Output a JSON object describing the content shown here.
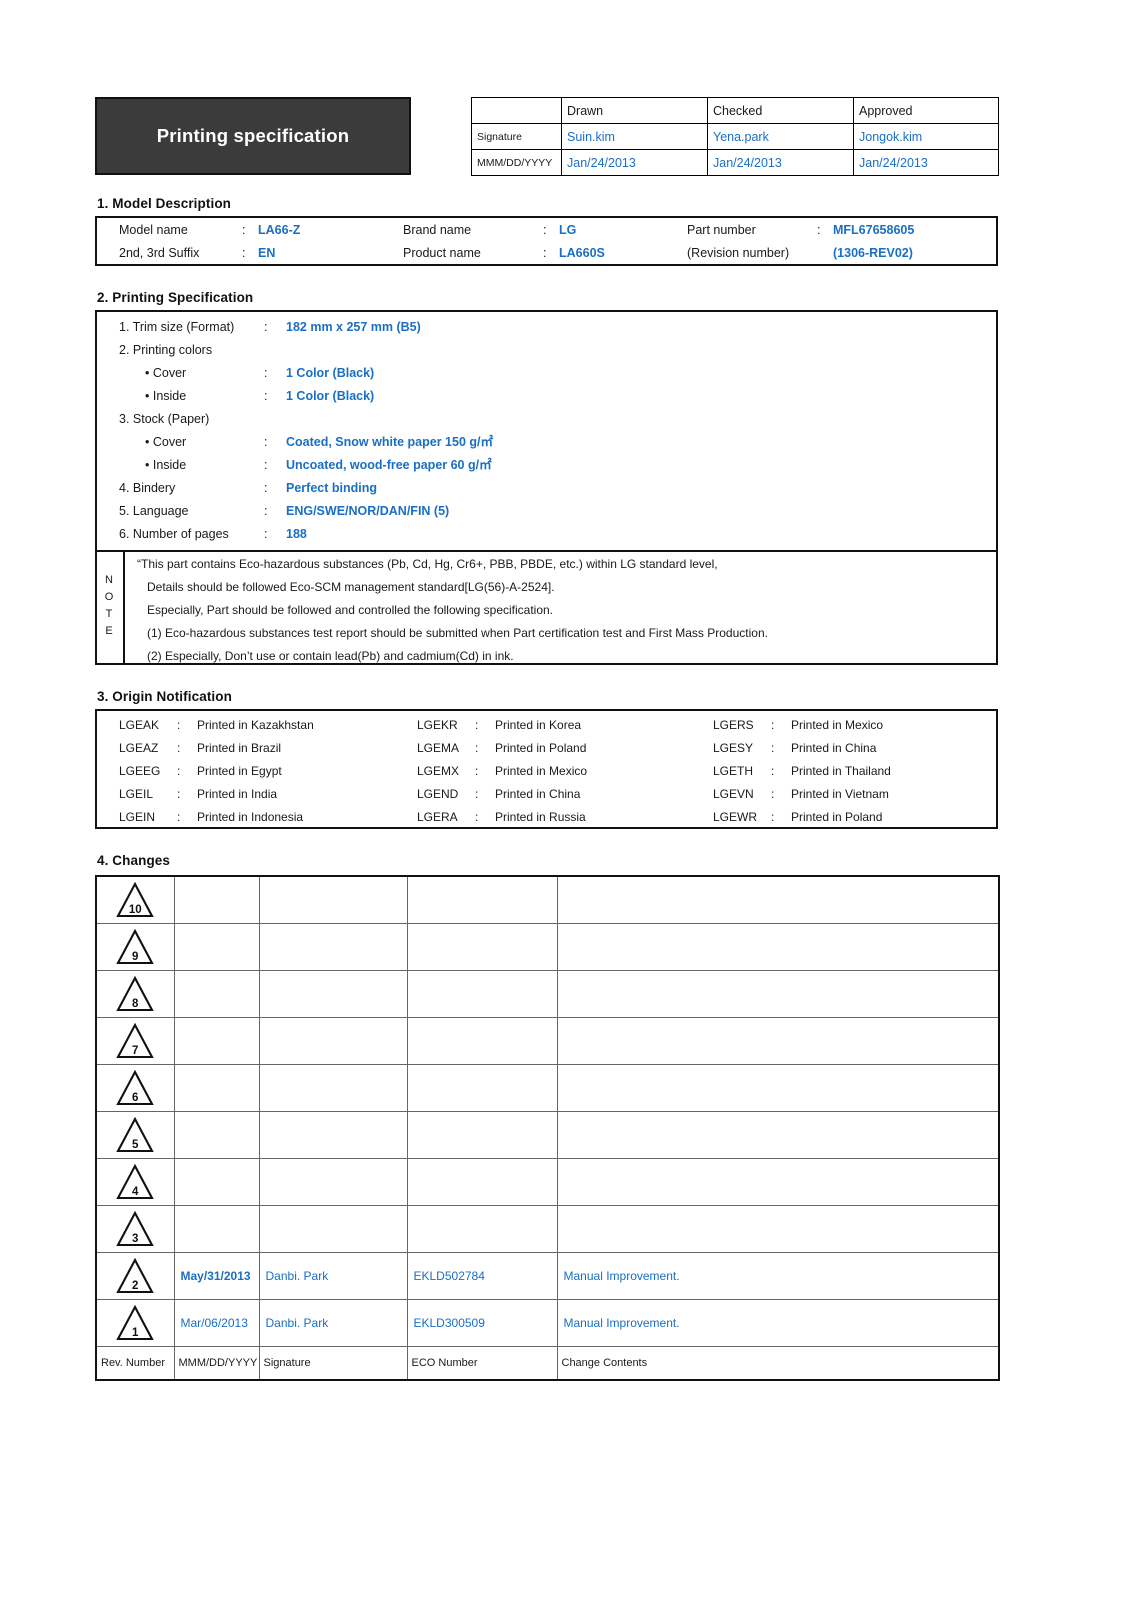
{
  "document": {
    "title": "Printing specification"
  },
  "approval": {
    "columns": [
      "Drawn",
      "Checked",
      "Approved"
    ],
    "rows": [
      {
        "label": "Signature",
        "values": [
          "Suin.kim",
          "Yena.park",
          "Jongok.kim"
        ]
      },
      {
        "label": "MMM/DD/YYYY",
        "values": [
          "Jan/24/2013",
          "Jan/24/2013",
          "Jan/24/2013"
        ]
      }
    ]
  },
  "sections": {
    "model": "1. Model Description",
    "printing": "2. Printing Specification",
    "origin": "3. Origin Notification",
    "changes": "4. Changes"
  },
  "model": {
    "colon": ":",
    "fields": [
      {
        "label": "Model name",
        "value": "LA66-Z"
      },
      {
        "label": "Brand name",
        "value": "LG"
      },
      {
        "label": "Part number",
        "value": "MFL67658605"
      },
      {
        "label": "2nd, 3rd Suffix",
        "value": "EN"
      },
      {
        "label": "Product name",
        "value": "LA660S"
      },
      {
        "label": "(Revision number)",
        "value": "(1306-REV02)"
      }
    ]
  },
  "printing": {
    "colon": ":",
    "items": [
      {
        "label": "1. Trim size (Format)",
        "value": "182 mm x 257 mm (B5)"
      },
      {
        "label": "2. Printing colors",
        "value": ""
      },
      {
        "label": "• Cover",
        "value": "1 Color (Black)"
      },
      {
        "label": "• Inside",
        "value": "1 Color (Black)"
      },
      {
        "label": "3. Stock (Paper)",
        "value": ""
      },
      {
        "label": "• Cover",
        "value": "Coated, Snow white paper 150 g/㎡"
      },
      {
        "label": "• Inside",
        "value": "Uncoated, wood-free paper 60 g/㎡"
      },
      {
        "label": "4. Bindery",
        "value": "Perfect binding"
      },
      {
        "label": "5. Language",
        "value": "ENG/SWE/NOR/DAN/FIN (5)"
      },
      {
        "label": "6. Number of pages",
        "value": "188"
      }
    ]
  },
  "note": {
    "vertical_label": "NOTE",
    "lines": [
      "“This part contains Eco-hazardous substances (Pb, Cd, Hg, Cr6+, PBB, PBDE, etc.) within LG standard level,",
      "Details should be followed Eco-SCM management standard[LG(56)-A-2524].",
      "Especially, Part should be followed and controlled the following specification.",
      "(1) Eco-hazardous substances test report should be submitted when Part certification test and First Mass Production.",
      "(2) Especially, Don’t use or contain lead(Pb) and cadmium(Cd) in ink."
    ]
  },
  "origin": {
    "colon": ":",
    "columns": [
      [
        {
          "code": "LGEAK",
          "place": "Printed in Kazakhstan"
        },
        {
          "code": "LGEAZ",
          "place": "Printed in Brazil"
        },
        {
          "code": "LGEEG",
          "place": "Printed in Egypt"
        },
        {
          "code": "LGEIL",
          "place": "Printed in India"
        },
        {
          "code": "LGEIN",
          "place": "Printed in Indonesia"
        }
      ],
      [
        {
          "code": "LGEKR",
          "place": "Printed in Korea"
        },
        {
          "code": "LGEMA",
          "place": "Printed in Poland"
        },
        {
          "code": "LGEMX",
          "place": "Printed in Mexico"
        },
        {
          "code": "LGEND",
          "place": "Printed in China"
        },
        {
          "code": "LGERA",
          "place": "Printed in Russia"
        }
      ],
      [
        {
          "code": "LGERS",
          "place": "Printed in Mexico"
        },
        {
          "code": "LGESY",
          "place": "Printed in China"
        },
        {
          "code": "LGETH",
          "place": "Printed in Thailand"
        },
        {
          "code": "LGEVN",
          "place": "Printed in Vietnam"
        },
        {
          "code": "LGEWR",
          "place": "Printed in Poland"
        }
      ]
    ]
  },
  "changes": {
    "footer": {
      "rev": "Rev. Number",
      "date": "MMM/DD/YYYY",
      "signature": "Signature",
      "eco": "ECO Number",
      "contents": "Change Contents"
    },
    "rows": [
      {
        "rev": "10",
        "date": "",
        "signature": "",
        "eco": "",
        "contents": "",
        "date_bold": false
      },
      {
        "rev": "9",
        "date": "",
        "signature": "",
        "eco": "",
        "contents": "",
        "date_bold": false
      },
      {
        "rev": "8",
        "date": "",
        "signature": "",
        "eco": "",
        "contents": "",
        "date_bold": false
      },
      {
        "rev": "7",
        "date": "",
        "signature": "",
        "eco": "",
        "contents": "",
        "date_bold": false
      },
      {
        "rev": "6",
        "date": "",
        "signature": "",
        "eco": "",
        "contents": "",
        "date_bold": false
      },
      {
        "rev": "5",
        "date": "",
        "signature": "",
        "eco": "",
        "contents": "",
        "date_bold": false
      },
      {
        "rev": "4",
        "date": "",
        "signature": "",
        "eco": "",
        "contents": "",
        "date_bold": false
      },
      {
        "rev": "3",
        "date": "",
        "signature": "",
        "eco": "",
        "contents": "",
        "date_bold": false
      },
      {
        "rev": "2",
        "date": "May/31/2013",
        "signature": "Danbi. Park",
        "eco": "EKLD502784",
        "contents": "Manual Improvement.",
        "date_bold": true
      },
      {
        "rev": "1",
        "date": "Mar/06/2013",
        "signature": "Danbi. Park",
        "eco": "EKLD300509",
        "contents": "Manual Improvement.",
        "date_bold": false
      }
    ]
  },
  "colors": {
    "accent_blue": "#1a6fc4",
    "title_bg": "#3b3b3b",
    "border": "#111111"
  }
}
